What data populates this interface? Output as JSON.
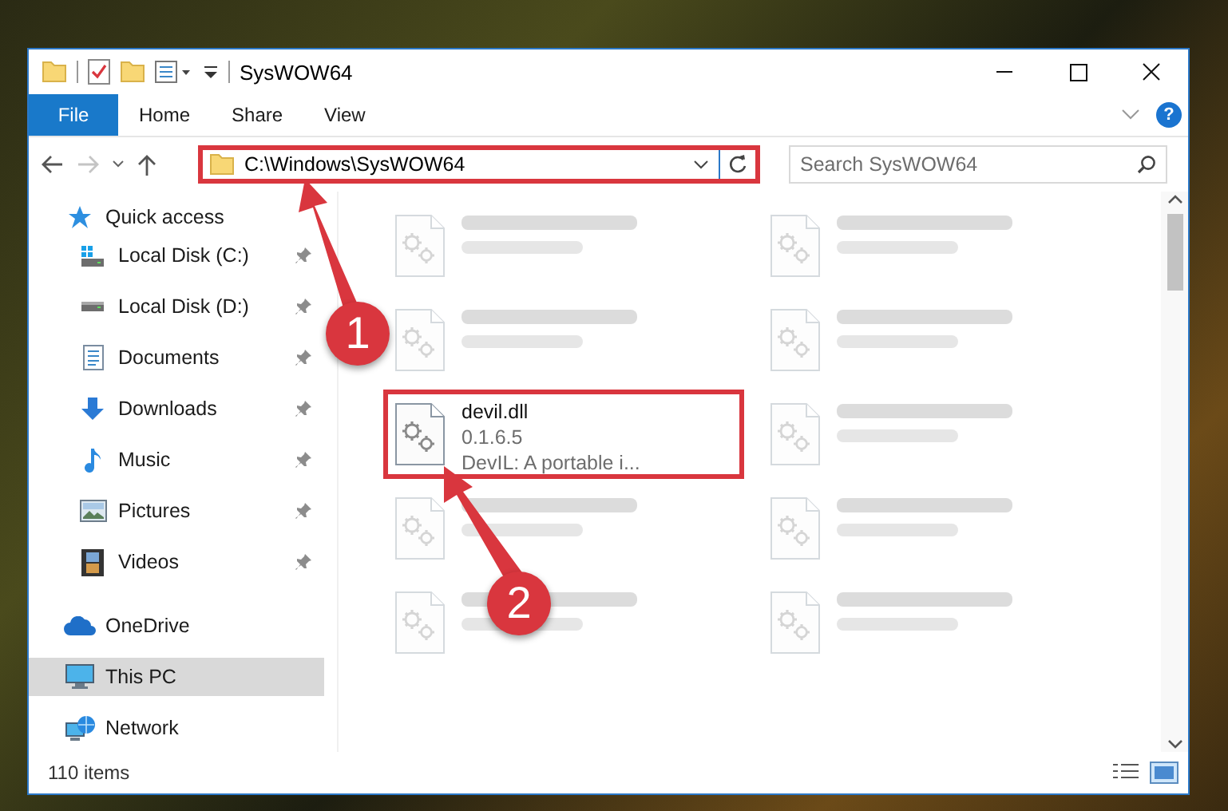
{
  "window": {
    "title": "SysWOW64"
  },
  "ribbon": {
    "file_tab": "File",
    "tabs": [
      "Home",
      "Share",
      "View"
    ],
    "help": "?"
  },
  "address_bar": {
    "value": "C:\\Windows\\SysWOW64",
    "highlighted": true
  },
  "search": {
    "placeholder": "Search SysWOW64"
  },
  "sidebar": {
    "items": [
      {
        "label": "Quick access",
        "kind": "quick",
        "selected": false,
        "children": [
          {
            "label": "Local Disk (C:)",
            "kind": "system-disk",
            "pinned": true,
            "selected": false
          },
          {
            "label": "Local Disk (D:)",
            "kind": "disk",
            "pinned": true,
            "selected": false
          },
          {
            "label": "Documents",
            "kind": "documents",
            "pinned": true,
            "selected": false
          },
          {
            "label": "Downloads",
            "kind": "downloads",
            "pinned": true,
            "selected": false
          },
          {
            "label": "Music",
            "kind": "music",
            "pinned": true,
            "selected": false
          },
          {
            "label": "Pictures",
            "kind": "pictures",
            "pinned": true,
            "selected": false
          },
          {
            "label": "Videos",
            "kind": "videos",
            "pinned": true,
            "selected": false
          }
        ]
      },
      {
        "label": "OneDrive",
        "kind": "cloud",
        "selected": false
      },
      {
        "label": "This PC",
        "kind": "pc",
        "selected": true
      },
      {
        "label": "Network",
        "kind": "network",
        "selected": false
      }
    ]
  },
  "files": [
    {
      "blurred": true,
      "highlighted": false
    },
    {
      "blurred": true,
      "highlighted": false
    },
    {
      "blurred": true,
      "highlighted": false
    },
    {
      "blurred": true,
      "highlighted": false
    },
    {
      "name": "devil.dll",
      "lines": [
        "0.1.6.5",
        "DevIL: A portable i..."
      ],
      "blurred": false,
      "highlighted": true
    },
    {
      "blurred": true,
      "highlighted": false
    },
    {
      "blurred": true,
      "highlighted": false
    },
    {
      "blurred": true,
      "highlighted": false
    },
    {
      "blurred": true,
      "highlighted": false
    },
    {
      "blurred": true,
      "highlighted": false
    }
  ],
  "status_bar": {
    "text": "110 items"
  },
  "annotations": [
    {
      "number": "1"
    },
    {
      "number": "2"
    }
  ]
}
